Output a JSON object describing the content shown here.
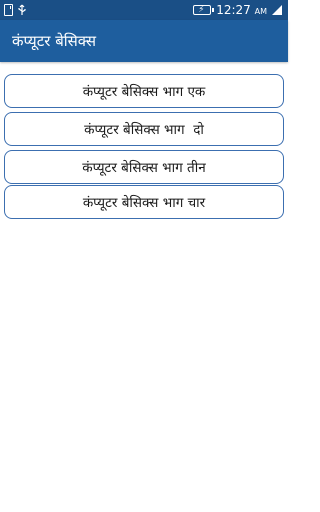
{
  "status_bar": {
    "time": "12:27",
    "ampm": "AM",
    "icons": [
      "sd-card-icon",
      "usb-icon",
      "battery-charging-icon",
      "signal-icon"
    ]
  },
  "app_bar": {
    "title": "कंप्यूटर बेसिक्स"
  },
  "menu": {
    "items": [
      {
        "label": "कंप्यूटर बेसिक्स भाग एक"
      },
      {
        "label": "कंप्यूटर बेसिक्स भाग  दो"
      },
      {
        "label": "कंप्यूटर बेसिक्स भाग तीन"
      },
      {
        "label": "कंप्यूटर बेसिक्स भाग चार"
      }
    ]
  },
  "colors": {
    "status_bar": "#1a4f86",
    "app_bar": "#1e5e9e",
    "button_border": "#3c6fb0"
  }
}
